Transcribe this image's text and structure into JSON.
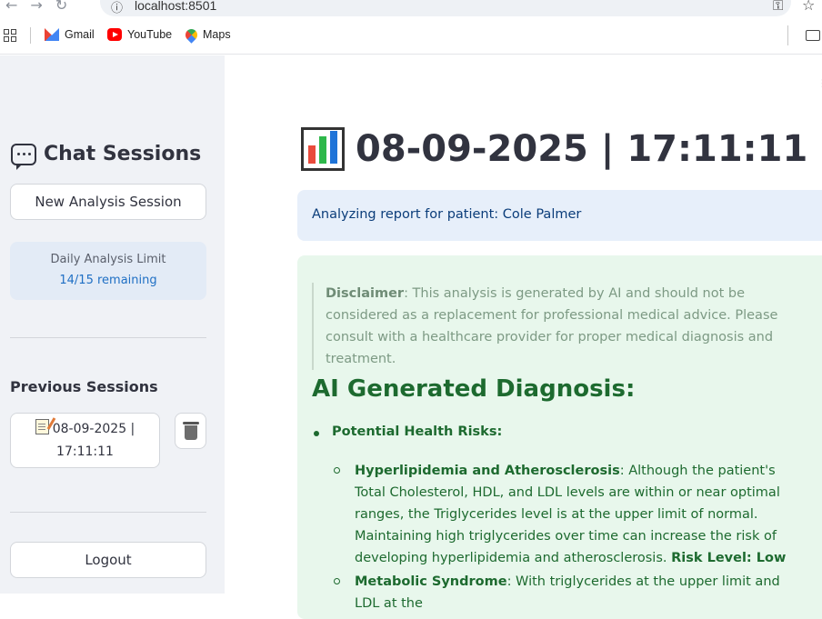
{
  "browser": {
    "url": "localhost:8501",
    "bookmarks": [
      {
        "label": "Gmail",
        "icon": "gmail-icon"
      },
      {
        "label": "YouTube",
        "icon": "youtube-icon"
      },
      {
        "label": "Maps",
        "icon": "maps-icon"
      }
    ]
  },
  "sidebar": {
    "title": "Chat Sessions",
    "new_session_label": "New Analysis Session",
    "limit_label": "Daily Analysis Limit",
    "limit_value": "14/15 remaining",
    "previous_title": "Previous Sessions",
    "session": {
      "line1": "08-09-2025 |",
      "line2": "17:11:11"
    },
    "logout_label": "Logout"
  },
  "main": {
    "title": "08-09-2025 | 17:11:11",
    "info": "Analyzing report for patient: Cole Palmer",
    "disclaimer_label": "Disclaimer",
    "disclaimer_text": ": This analysis is generated by AI and should not be considered as a replacement for professional medical advice. Please consult with a healthcare provider for proper medical diagnosis and treatment.",
    "diagnosis_heading": "AI Generated Diagnosis:",
    "risks_label": "Potential Health Risks:",
    "risks": [
      {
        "name": "Hyperlipidemia and Atherosclerosis",
        "text": ": Although the patient's Total Cholesterol, HDL, and LDL levels are within or near optimal ranges, the Triglycerides level is at the upper limit of normal. Maintaining high triglycerides over time can increase the risk of developing hyperlipidemia and atherosclerosis. ",
        "risk_level": "Risk Level: Low"
      },
      {
        "name": "Metabolic Syndrome",
        "text": ": With triglycerides at the upper limit and LDL at the"
      }
    ]
  },
  "colors": {
    "sidebar_bg": "#f0f2f6",
    "info_bg": "#e7effa",
    "success_bg": "#e8f7ec",
    "success_text": "#1d6a2f",
    "link_blue": "#1f6fc4"
  }
}
